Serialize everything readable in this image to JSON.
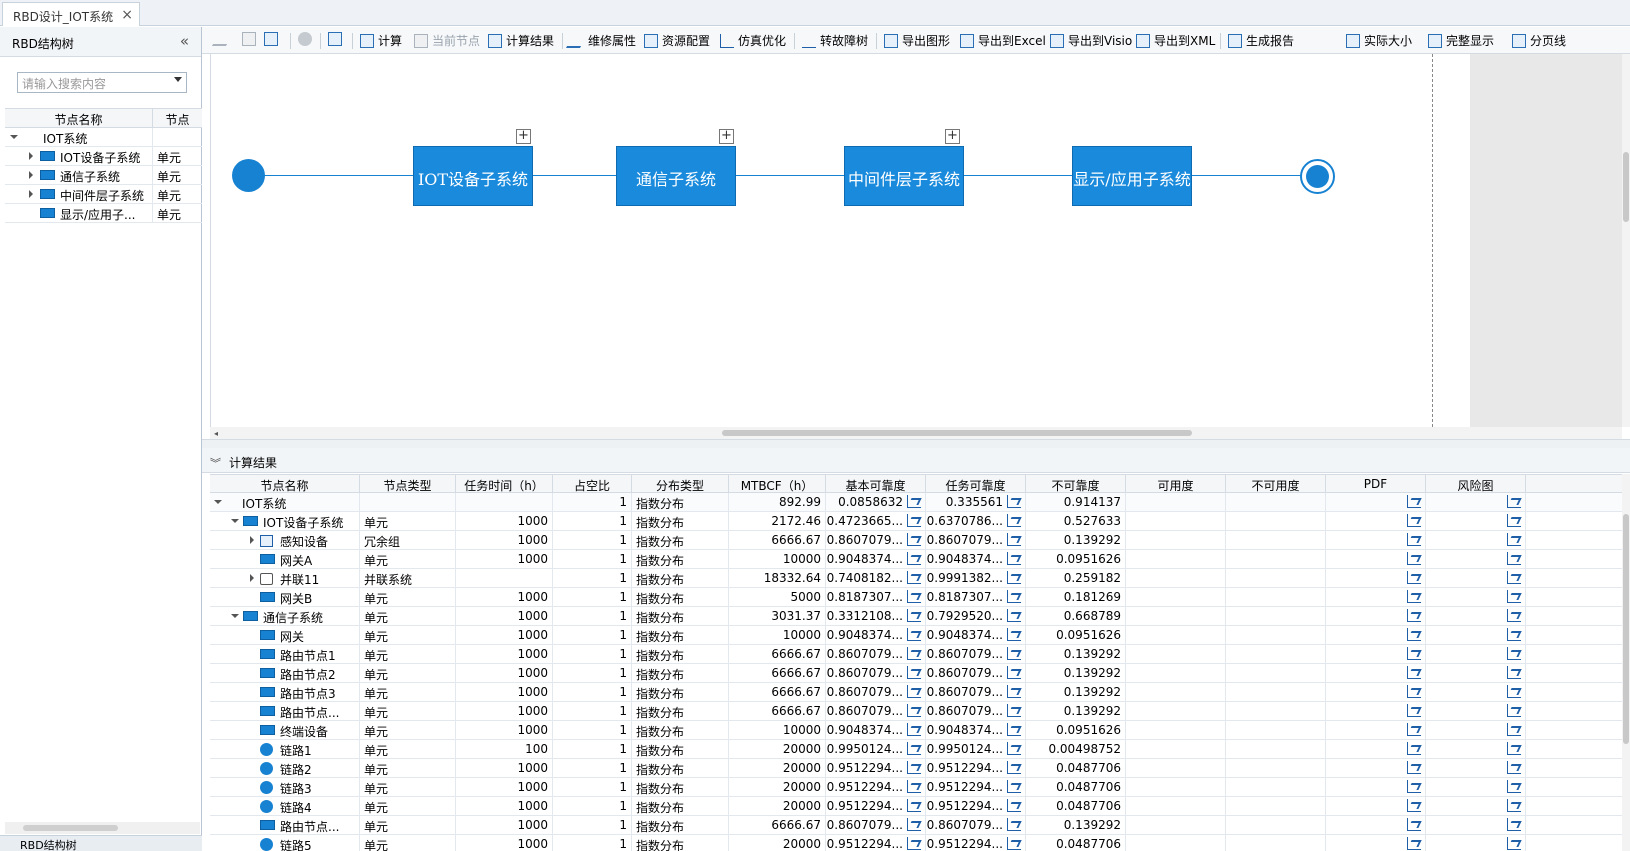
{
  "tab": {
    "title": "RBD设计_IOT系统"
  },
  "left_panel": {
    "title": "RBD结构树",
    "search_placeholder": "请输入搜索内容",
    "columns": [
      "节点名称",
      "节点"
    ],
    "items": [
      {
        "name": "IOT系统",
        "type": ""
      },
      {
        "name": "IOT设备子系统",
        "type": "单元"
      },
      {
        "name": "通信子系统",
        "type": "单元"
      },
      {
        "name": "中间件层子系统",
        "type": "单元"
      },
      {
        "name": "显示/应用子...",
        "type": "单元"
      }
    ],
    "bottom_tab": "RBD结构树"
  },
  "toolbar": {
    "calc": "计算",
    "current_node": "当前节点",
    "calc_result": "计算结果",
    "maintain": "维修属性",
    "resource": "资源配置",
    "simulate": "仿真优化",
    "fault_tree": "转故障树",
    "export_img": "导出图形",
    "export_excel": "导出到Excel",
    "export_visio": "导出到Visio",
    "export_xml": "导出到XML",
    "report": "生成报告",
    "actual_size": "实际大小",
    "fit": "完整显示",
    "page_line": "分页线"
  },
  "diagram": {
    "blocks": [
      "IOT设备子系统",
      "通信子系统",
      "中间件层子系统",
      "显示/应用子系统"
    ],
    "plus": "+"
  },
  "results": {
    "title": "计算结果",
    "columns": [
      "节点名称",
      "节点类型",
      "任务时间（h）",
      "占空比",
      "分布类型",
      "MTBCF（h）",
      "基本可靠度",
      "任务可靠度",
      "不可靠度",
      "可用度",
      "不可用度",
      "PDF",
      "风险图"
    ],
    "rows": [
      {
        "name": "IOT系统",
        "type": "",
        "time": "",
        "duty": "1",
        "dist": "指数分布",
        "mtbcf": "892.99",
        "basic": "0.0858632",
        "task": "0.335561",
        "unrel": "0.914137"
      },
      {
        "name": "IOT设备子系统",
        "type": "单元",
        "time": "1000",
        "duty": "1",
        "dist": "指数分布",
        "mtbcf": "2172.46",
        "basic": "0.4723665...",
        "task": "0.6370786...",
        "unrel": "0.527633"
      },
      {
        "name": "感知设备",
        "type": "冗余组",
        "time": "1000",
        "duty": "1",
        "dist": "指数分布",
        "mtbcf": "6666.67",
        "basic": "0.8607079...",
        "task": "0.8607079...",
        "unrel": "0.139292"
      },
      {
        "name": "网关A",
        "type": "单元",
        "time": "1000",
        "duty": "1",
        "dist": "指数分布",
        "mtbcf": "10000",
        "basic": "0.9048374...",
        "task": "0.9048374...",
        "unrel": "0.0951626"
      },
      {
        "name": "并联11",
        "type": "并联系统",
        "time": "",
        "duty": "1",
        "dist": "指数分布",
        "mtbcf": "18332.64",
        "basic": "0.7408182...",
        "task": "0.9991382...",
        "unrel": "0.259182"
      },
      {
        "name": "网关B",
        "type": "单元",
        "time": "1000",
        "duty": "1",
        "dist": "指数分布",
        "mtbcf": "5000",
        "basic": "0.8187307...",
        "task": "0.8187307...",
        "unrel": "0.181269"
      },
      {
        "name": "通信子系统",
        "type": "单元",
        "time": "1000",
        "duty": "1",
        "dist": "指数分布",
        "mtbcf": "3031.37",
        "basic": "0.3312108...",
        "task": "0.7929520...",
        "unrel": "0.668789"
      },
      {
        "name": "网关",
        "type": "单元",
        "time": "1000",
        "duty": "1",
        "dist": "指数分布",
        "mtbcf": "10000",
        "basic": "0.9048374...",
        "task": "0.9048374...",
        "unrel": "0.0951626"
      },
      {
        "name": "路由节点1",
        "type": "单元",
        "time": "1000",
        "duty": "1",
        "dist": "指数分布",
        "mtbcf": "6666.67",
        "basic": "0.8607079...",
        "task": "0.8607079...",
        "unrel": "0.139292"
      },
      {
        "name": "路由节点2",
        "type": "单元",
        "time": "1000",
        "duty": "1",
        "dist": "指数分布",
        "mtbcf": "6666.67",
        "basic": "0.8607079...",
        "task": "0.8607079...",
        "unrel": "0.139292"
      },
      {
        "name": "路由节点3",
        "type": "单元",
        "time": "1000",
        "duty": "1",
        "dist": "指数分布",
        "mtbcf": "6666.67",
        "basic": "0.8607079...",
        "task": "0.8607079...",
        "unrel": "0.139292"
      },
      {
        "name": "路由节点...",
        "type": "单元",
        "time": "1000",
        "duty": "1",
        "dist": "指数分布",
        "mtbcf": "6666.67",
        "basic": "0.8607079...",
        "task": "0.8607079...",
        "unrel": "0.139292"
      },
      {
        "name": "终端设备",
        "type": "单元",
        "time": "1000",
        "duty": "1",
        "dist": "指数分布",
        "mtbcf": "10000",
        "basic": "0.9048374...",
        "task": "0.9048374...",
        "unrel": "0.0951626"
      },
      {
        "name": "链路1",
        "type": "单元",
        "time": "100",
        "duty": "1",
        "dist": "指数分布",
        "mtbcf": "20000",
        "basic": "0.9950124...",
        "task": "0.9950124...",
        "unrel": "0.00498752"
      },
      {
        "name": "链路2",
        "type": "单元",
        "time": "1000",
        "duty": "1",
        "dist": "指数分布",
        "mtbcf": "20000",
        "basic": "0.9512294...",
        "task": "0.9512294...",
        "unrel": "0.0487706"
      },
      {
        "name": "链路3",
        "type": "单元",
        "time": "1000",
        "duty": "1",
        "dist": "指数分布",
        "mtbcf": "20000",
        "basic": "0.9512294...",
        "task": "0.9512294...",
        "unrel": "0.0487706"
      },
      {
        "name": "链路4",
        "type": "单元",
        "time": "1000",
        "duty": "1",
        "dist": "指数分布",
        "mtbcf": "20000",
        "basic": "0.9512294...",
        "task": "0.9512294...",
        "unrel": "0.0487706"
      },
      {
        "name": "路由节点...",
        "type": "单元",
        "time": "1000",
        "duty": "1",
        "dist": "指数分布",
        "mtbcf": "6666.67",
        "basic": "0.8607079...",
        "task": "0.8607079...",
        "unrel": "0.139292"
      },
      {
        "name": "链路5",
        "type": "单元",
        "time": "1000",
        "duty": "1",
        "dist": "指数分布",
        "mtbcf": "20000",
        "basic": "0.9512294...",
        "task": "0.9512294...",
        "unrel": "0.0487706"
      }
    ]
  },
  "colors": {
    "accent": "#1782d1",
    "block": "#1a8bdc"
  }
}
